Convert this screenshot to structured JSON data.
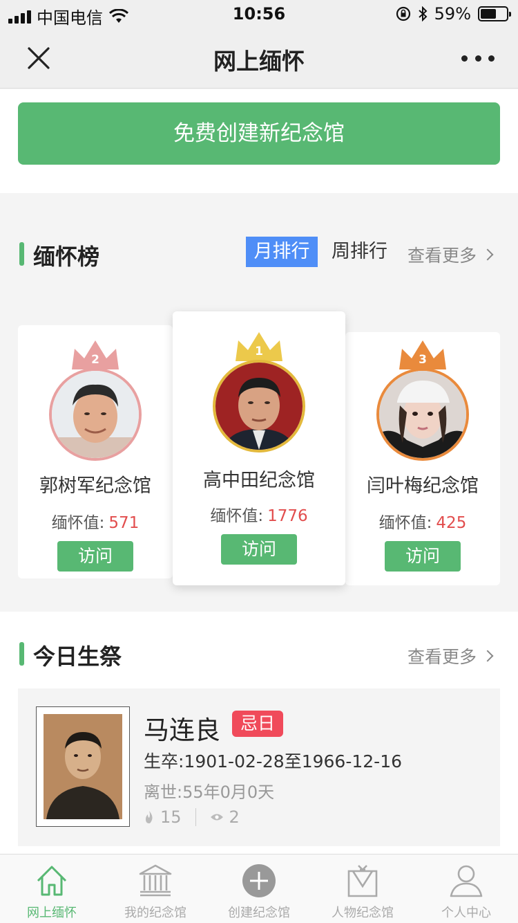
{
  "status_bar": {
    "carrier": "中国电信",
    "time": "10:56",
    "battery": "59%"
  },
  "nav": {
    "title": "网上缅怀",
    "close_icon": "close-icon",
    "more_icon": "more-icon"
  },
  "create": {
    "label": "免费创建新纪念馆"
  },
  "ranking": {
    "title": "缅怀榜",
    "tab_month": "月排行",
    "tab_week": "周排行",
    "see_more": "查看更多",
    "score_label": "缅怀值:",
    "cards": [
      {
        "rank": "2",
        "name": "郭树军纪念馆",
        "score": "571",
        "visit": "访问",
        "crown_color": "#e8a0a0"
      },
      {
        "rank": "1",
        "name": "高中田纪念馆",
        "score": "1776",
        "visit": "访问",
        "crown_color": "#ecc94b"
      },
      {
        "rank": "3",
        "name": "闫叶梅纪念馆",
        "score": "425",
        "visit": "访问",
        "crown_color": "#e98a3c"
      }
    ]
  },
  "today": {
    "title": "今日生祭",
    "see_more": "查看更多",
    "item": {
      "name": "马连良",
      "badge": "忌日",
      "dates": "生卒:1901-02-28至1966-12-16",
      "passed": "离世:55年0月0天",
      "flowers": "15",
      "views": "2"
    }
  },
  "tabbar": [
    {
      "label": "网上缅怀",
      "icon": "home-icon",
      "active": true
    },
    {
      "label": "我的纪念馆",
      "icon": "memorial-hall-icon",
      "active": false
    },
    {
      "label": "创建纪念馆",
      "icon": "plus-circle-icon",
      "active": false
    },
    {
      "label": "人物纪念馆",
      "icon": "person-memorial-icon",
      "active": false
    },
    {
      "label": "个人中心",
      "icon": "user-icon",
      "active": false
    }
  ],
  "colors": {
    "accent_green": "#58b873",
    "tab_blue": "#4f8ef7",
    "score_red": "#e24d4d",
    "badge_red": "#f04a5a"
  }
}
